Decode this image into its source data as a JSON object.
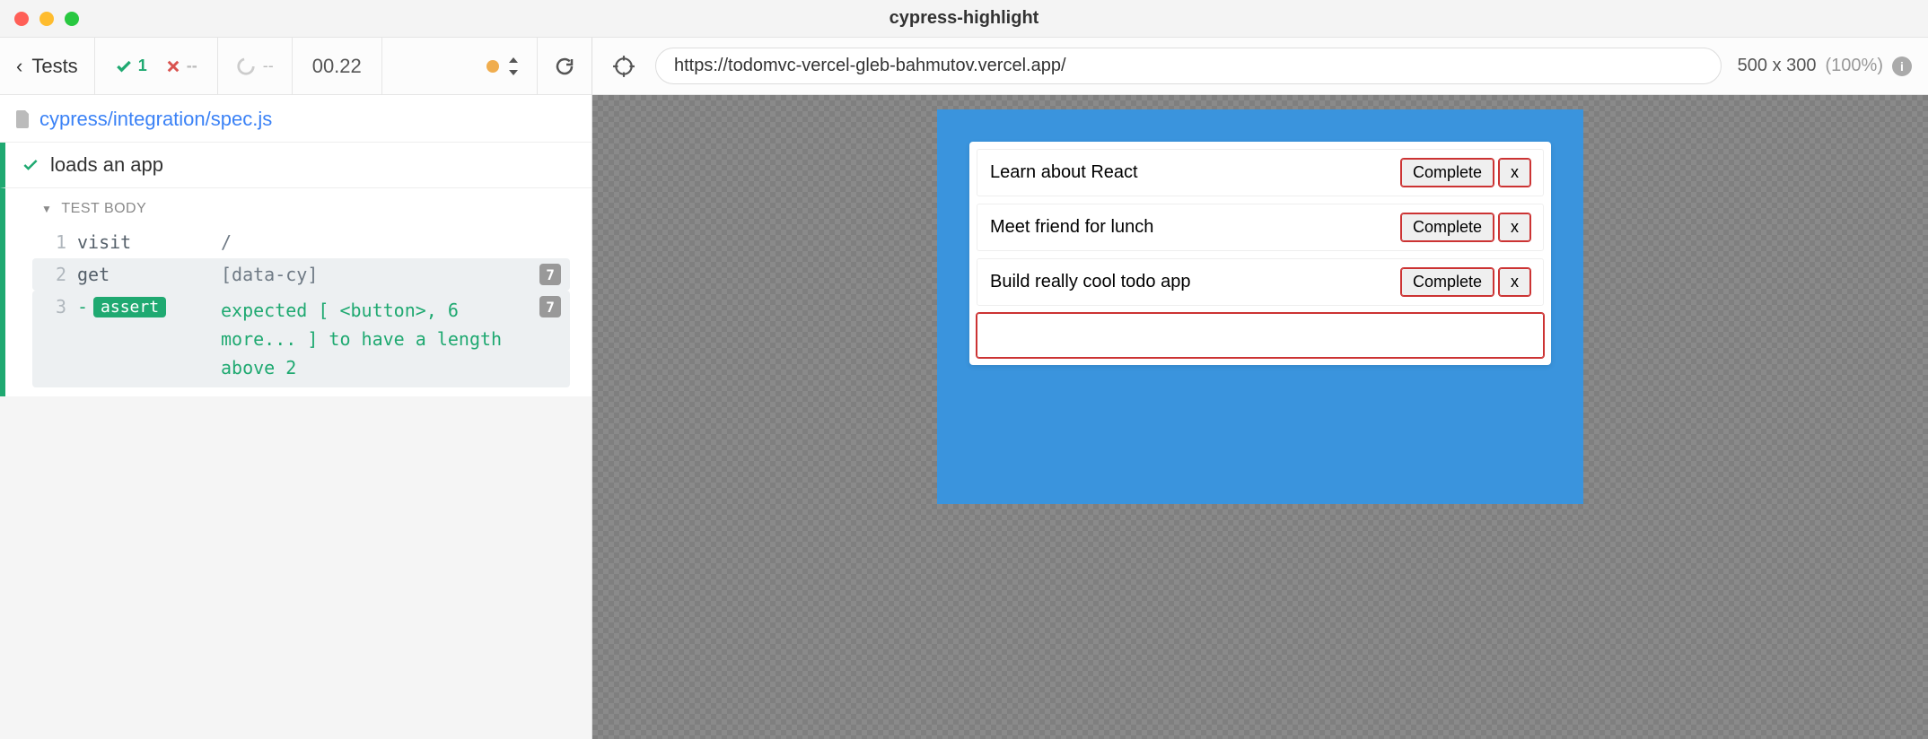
{
  "window": {
    "title": "cypress-highlight"
  },
  "stats": {
    "back_label": "Tests",
    "passed": "1",
    "failed": "--",
    "pending": "--",
    "time": "00.22"
  },
  "spec": {
    "path": "cypress/integration/spec.js"
  },
  "test": {
    "title": "loads an app",
    "body_label": "TEST BODY",
    "commands": [
      {
        "ln": "1",
        "name": "visit",
        "args": "/",
        "count": ""
      },
      {
        "ln": "2",
        "name": "get",
        "args": "[data-cy]",
        "count": "7"
      },
      {
        "ln": "3",
        "name": "assert",
        "text": "expected [ <button>, 6 more... ] to have a length above 2",
        "count": "7"
      }
    ]
  },
  "preview": {
    "url": "https://todomvc-vercel-gleb-bahmutov.vercel.app/",
    "viewport": "500 x 300",
    "scale": "(100%)"
  },
  "app": {
    "todos": [
      {
        "text": "Learn about React",
        "complete": "Complete",
        "remove": "x"
      },
      {
        "text": "Meet friend for lunch",
        "complete": "Complete",
        "remove": "x"
      },
      {
        "text": "Build really cool todo app",
        "complete": "Complete",
        "remove": "x"
      }
    ],
    "input_placeholder": ""
  }
}
